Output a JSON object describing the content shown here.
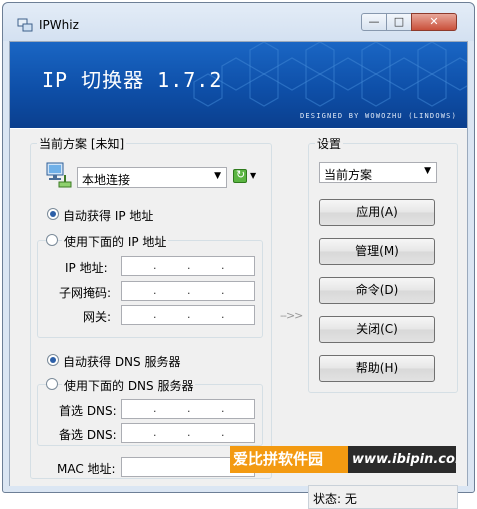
{
  "window": {
    "title": "IPWhiz"
  },
  "banner": {
    "title": "IP 切换器 1.7.2",
    "credit": "DESIGNED BY WOWOZHU (LINDOWS)"
  },
  "current": {
    "legend": "当前方案 [未知]",
    "adapter": "本地连接",
    "auto_ip": "自动获得 IP 地址",
    "manual_ip": "使用下面的 IP 地址",
    "ip_label": "IP 地址:",
    "mask_label": "子网掩码:",
    "gateway_label": "网关:",
    "auto_dns": "自动获得 DNS 服务器",
    "manual_dns": "使用下面的 DNS 服务器",
    "dns1_label": "首选 DNS:",
    "dns2_label": "备选 DNS:",
    "mac_label": "MAC 地址:",
    "ip_dot": "."
  },
  "settings": {
    "legend": "设置",
    "scheme": "当前方案",
    "apply": "应用(A)",
    "manage": "管理(M)",
    "command": "命令(D)",
    "close": "关闭(C)",
    "help": "帮助(H)"
  },
  "arrow_hint": "-->>",
  "status": {
    "text": "状态: 无"
  },
  "watermark": {
    "left": "爱比拼软件园",
    "right": "www.ibipin.com"
  }
}
